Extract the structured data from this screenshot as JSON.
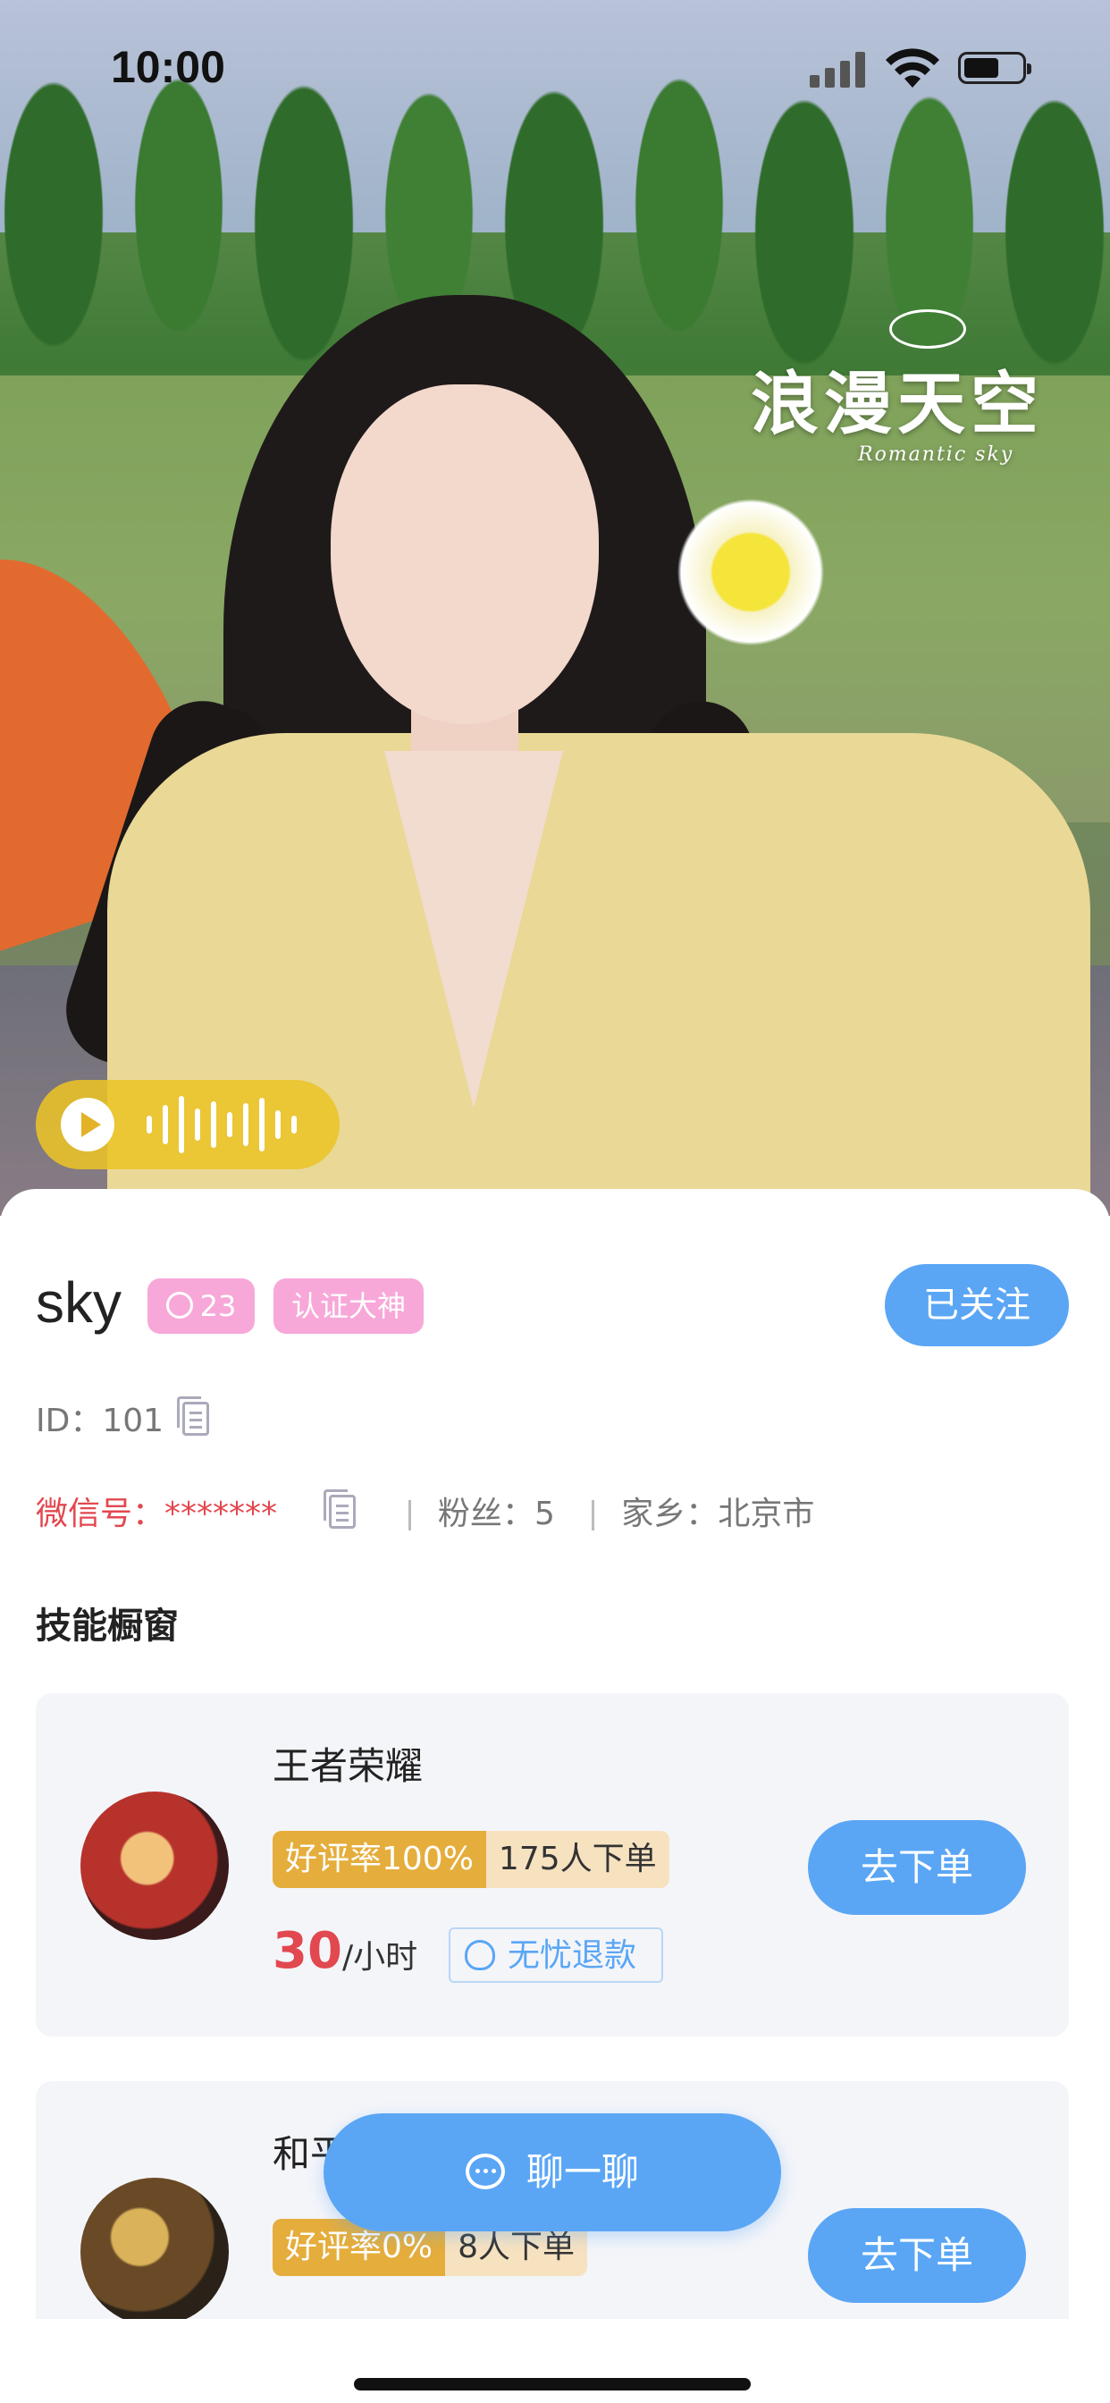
{
  "status_bar": {
    "time": "10:00",
    "battery_level": 0.6
  },
  "hero": {
    "watermark_title": "浪漫天空",
    "watermark_subtitle": "Romantic sky",
    "audio_player": {
      "icon": "play-icon"
    }
  },
  "profile": {
    "name": "sky",
    "chat_tag": "23",
    "verified_tag": "认证大神",
    "follow_label": "已关注",
    "id_label": "ID：",
    "id_value": "101",
    "wechat_label": "微信号：",
    "wechat_value": "*******",
    "fans_label": "粉丝：",
    "fans_value": "5",
    "hometown_label": "家乡：",
    "hometown_value": "北京市"
  },
  "skills": {
    "title": "技能橱窗",
    "items": [
      {
        "game": "王者荣耀",
        "rating": "好评率100%",
        "orders": "175人下单",
        "price": "30",
        "unit": "/小时",
        "refund": "无忧退款",
        "order_label": "去下单"
      },
      {
        "game": "和平精英",
        "rating": "好评率0%",
        "orders": "8人下单",
        "order_label": "去下单"
      }
    ]
  },
  "chat_button": {
    "label": "聊一聊"
  },
  "colors": {
    "accent": "#5aa6f5",
    "tag_pink": "#f7a8d8",
    "price_red": "#e2484f",
    "rating_gold": "#e5ad3c"
  }
}
